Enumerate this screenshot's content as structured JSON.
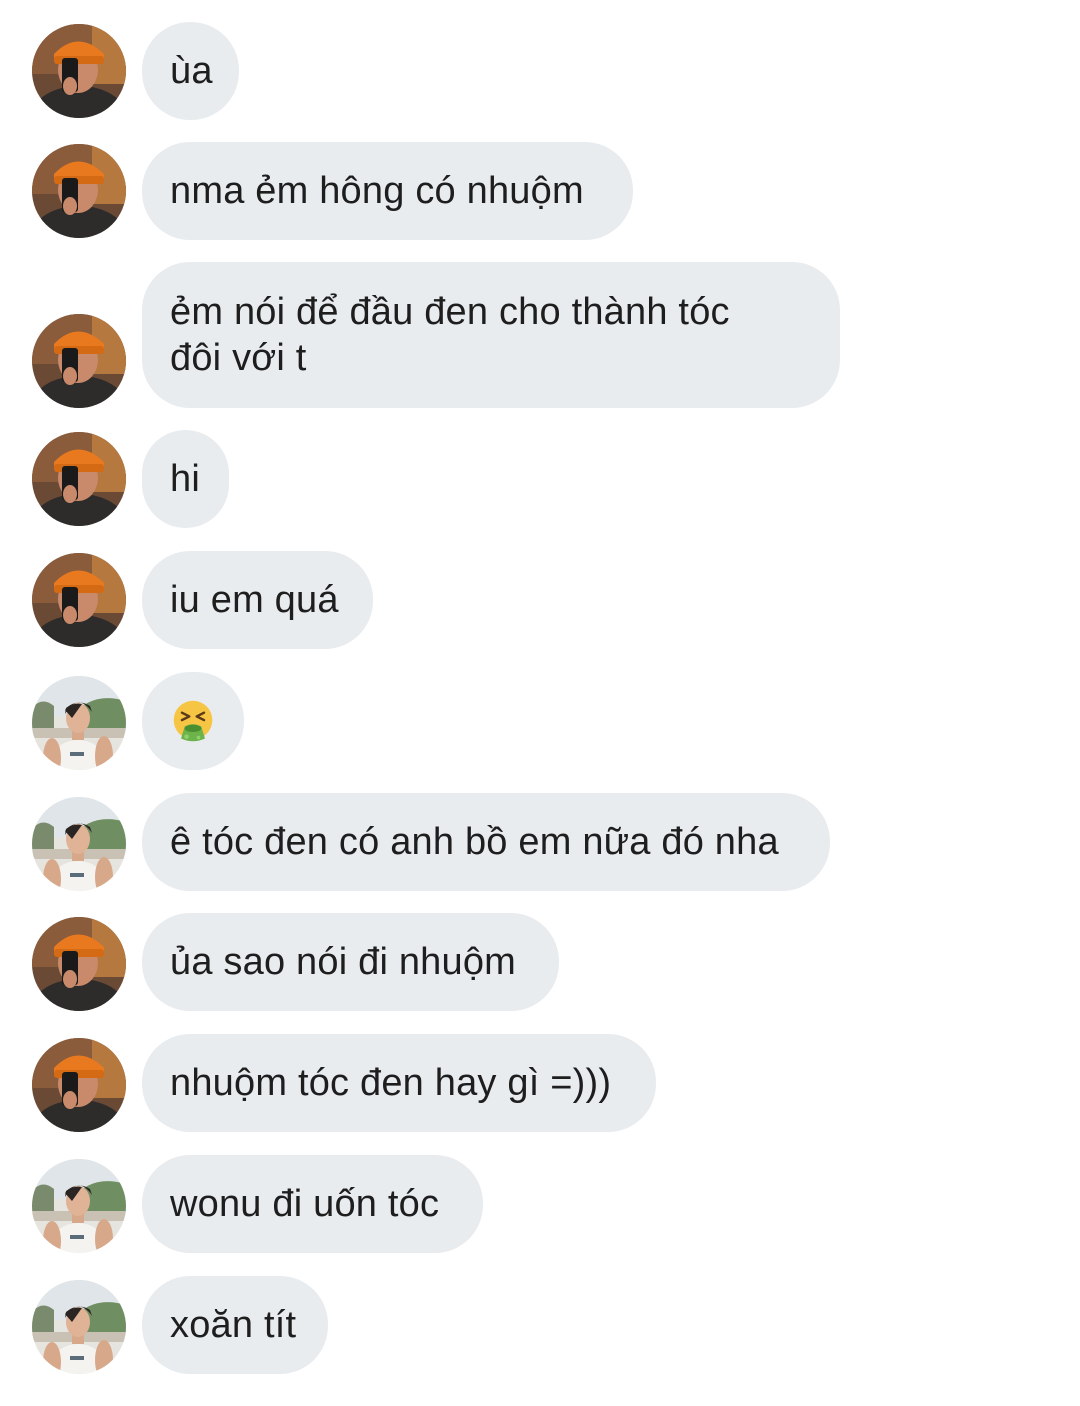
{
  "conversation": {
    "messages": [
      {
        "sender": "orange-beanie",
        "text": "ùa"
      },
      {
        "sender": "orange-beanie",
        "text": "nma ẻm hông có nhuộm"
      },
      {
        "sender": "orange-beanie",
        "text": "ẻm nói để đầu đen cho thành tóc\nđôi với t"
      },
      {
        "sender": "orange-beanie",
        "text": "hi"
      },
      {
        "sender": "orange-beanie",
        "text": "iu em quá"
      },
      {
        "sender": "white-tank",
        "emoji": "vomiting-face-emoji"
      },
      {
        "sender": "white-tank",
        "text": "ê tóc đen có anh bồ em nữa đó nha"
      },
      {
        "sender": "orange-beanie",
        "text": "ủa sao nói đi nhuộm"
      },
      {
        "sender": "orange-beanie",
        "text": "nhuộm tóc đen hay gì =)))"
      },
      {
        "sender": "white-tank",
        "text": "wonu đi uốn tóc"
      },
      {
        "sender": "white-tank",
        "text": "xoăn tít"
      }
    ]
  },
  "colors": {
    "bubble": "#e9ecef",
    "text": "#1e1e1e",
    "background": "#ffffff"
  }
}
